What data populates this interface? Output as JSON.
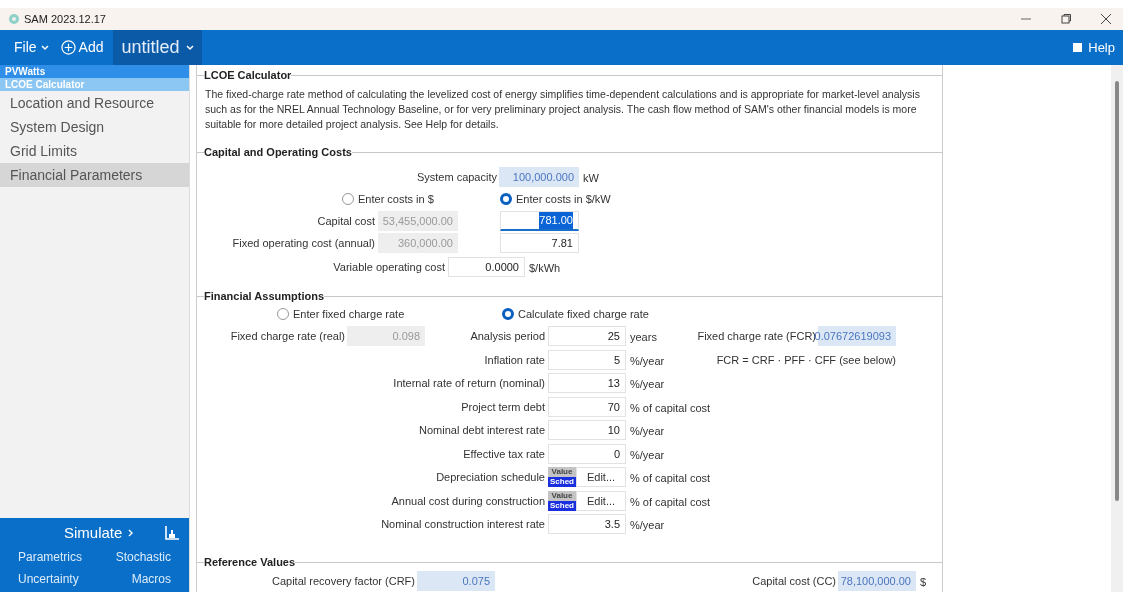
{
  "window": {
    "title": "SAM 2023.12.17"
  },
  "menu": {
    "file": "File",
    "add": "Add",
    "case": "untitled",
    "help": "Help"
  },
  "sidebar": {
    "technology": "PVWatts",
    "financial_model": "LCOE Calculator",
    "items": [
      {
        "label": "Location and Resource",
        "selected": false
      },
      {
        "label": "System Design",
        "selected": false
      },
      {
        "label": "Grid Limits",
        "selected": false
      },
      {
        "label": "Financial Parameters",
        "selected": true
      }
    ],
    "simulate": "Simulate",
    "links": [
      "Parametrics",
      "Stochastic",
      "Uncertainty",
      "Macros"
    ]
  },
  "page": {
    "title": "LCOE Calculator",
    "description": "The fixed-charge rate method of calculating the levelized cost of energy simplifies time-dependent calculations and is appropriate for market-level analysis such as for the NREL Annual Technology Baseline, or for very preliminary project analysis. The cash flow method of SAM's other financial models is more suitable for more detailed project analysis. See Help for details.",
    "capital": {
      "title": "Capital and Operating Costs",
      "system_capacity": {
        "label": "System capacity",
        "value": "100,000.000",
        "unit": "kW"
      },
      "cost_mode": [
        {
          "label": "Enter costs in $",
          "selected": false
        },
        {
          "label": "Enter costs in $/kW",
          "selected": true
        }
      ],
      "capital_cost": {
        "label": "Capital cost",
        "total": "53,455,000.00",
        "per_kw": "781.00",
        "focused": true
      },
      "fixed_operating_cost": {
        "label": "Fixed operating cost (annual)",
        "total": "360,000.00",
        "per_kw": "7.81",
        "focused": false
      },
      "variable_operating_cost": {
        "label": "Variable operating cost",
        "value": "0.0000",
        "unit": "$/kWh"
      }
    },
    "financial": {
      "title": "Financial Assumptions",
      "rate_mode": [
        {
          "label": "Enter fixed charge rate",
          "selected": false
        },
        {
          "label": "Calculate fixed charge rate",
          "selected": true
        }
      ],
      "fixed_charge_rate_real": {
        "label": "Fixed charge rate (real)",
        "value": "0.098"
      },
      "fcr": {
        "label": "Fixed charge rate (FCR)",
        "value": "0.07672619093"
      },
      "formula": "FCR = CRF · PFF · CFF (see below)",
      "inputs": [
        {
          "kind": "number",
          "label": "Analysis period",
          "value": "25",
          "unit": "years"
        },
        {
          "kind": "number",
          "label": "Inflation rate",
          "value": "5",
          "unit": "%/year"
        },
        {
          "kind": "number",
          "label": "Internal rate of return (nominal)",
          "value": "13",
          "unit": "%/year"
        },
        {
          "kind": "number",
          "label": "Project term debt",
          "value": "70",
          "unit": "% of capital cost"
        },
        {
          "kind": "number",
          "label": "Nominal debt interest rate",
          "value": "10",
          "unit": "%/year"
        },
        {
          "kind": "number",
          "label": "Effective tax rate",
          "value": "0",
          "unit": "%/year"
        },
        {
          "kind": "schedule",
          "label": "Depreciation schedule",
          "toggle": [
            {
              "label": "Value",
              "selected": false
            },
            {
              "label": "Sched",
              "selected": true
            }
          ],
          "button": "Edit...",
          "unit": "% of capital cost"
        },
        {
          "kind": "schedule",
          "label": "Annual cost during construction",
          "toggle": [
            {
              "label": "Value",
              "selected": false
            },
            {
              "label": "Sched",
              "selected": true
            }
          ],
          "button": "Edit...",
          "unit": "% of capital cost"
        },
        {
          "kind": "number",
          "label": "Nominal construction interest rate",
          "value": "3.5",
          "unit": "%/year"
        }
      ]
    },
    "reference": {
      "title": "Reference Values",
      "items": [
        {
          "label": "Capital recovery factor (CRF)",
          "value": "0.075"
        },
        {
          "label": "Capital cost (CC)",
          "value": "78,100,000.00",
          "unit": "$"
        }
      ]
    }
  }
}
